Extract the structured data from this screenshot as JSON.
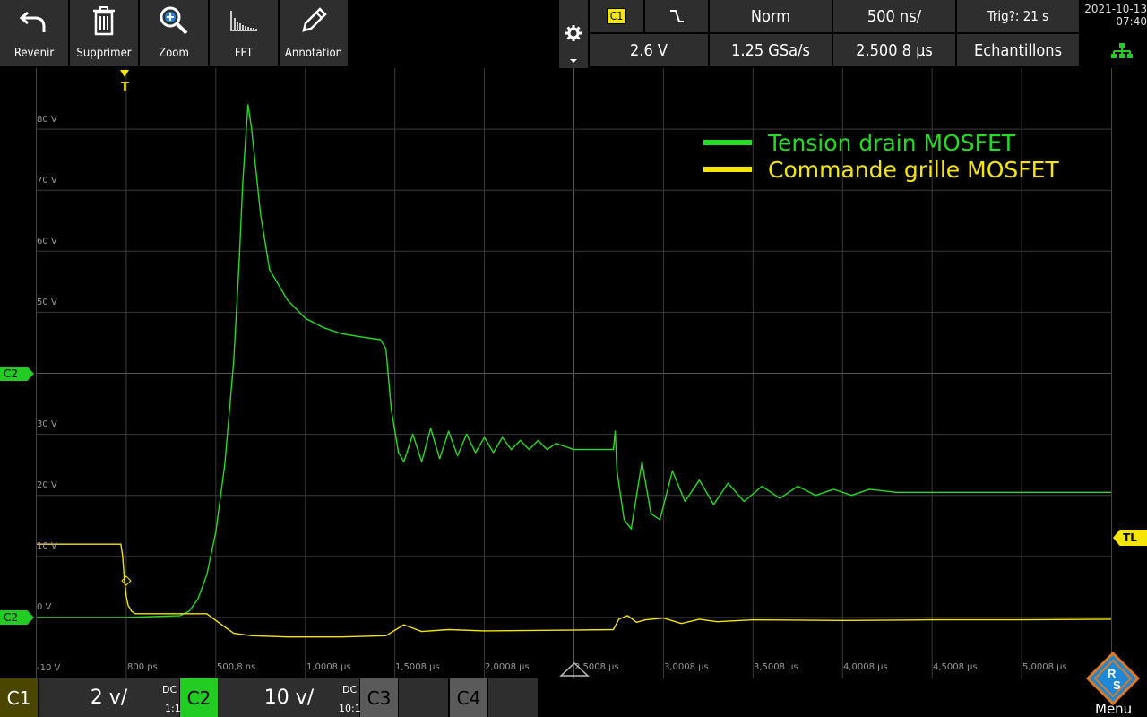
{
  "toolbar": {
    "buttons": [
      {
        "label": "Revenir",
        "icon": "undo-icon"
      },
      {
        "label": "Supprimer",
        "icon": "trash-icon"
      },
      {
        "label": "Zoom",
        "icon": "zoom-icon"
      },
      {
        "label": "FFT",
        "icon": "fft-icon"
      },
      {
        "label": "Annotation",
        "icon": "pencil-icon"
      }
    ],
    "trigger_source": "C1",
    "trigger_mode": "Norm",
    "timebase": "500 ns/",
    "trigger_status": "Trig?: 21 s",
    "trigger_level": "2.6 V",
    "sample_rate": "1.25 GSa/s",
    "position": "2.500 8 µs",
    "acquisition": "Echantillons",
    "date": "2021-10-13",
    "time": "07:40"
  },
  "grid": {
    "y_labels": [
      "80 V",
      "70 V",
      "60 V",
      "50 V",
      "30 V",
      "20 V",
      "10 V",
      "0 V",
      "-10 V"
    ],
    "x_labels": [
      "800 ps",
      "500,8 ns",
      "1,0008 µs",
      "1,5008 µs",
      "2,0008 µs",
      "2,5008 µs",
      "3,0008 µs",
      "3,5008 µs",
      "4,0008 µs",
      "4,5008 µs",
      "5,0008 µs"
    ],
    "marker_c2_upper": "C2",
    "marker_c2_lower": "C2",
    "marker_trigger_level": "TL",
    "trigger_pos_label": "T"
  },
  "legend": {
    "series_1": "Tension drain MOSFET",
    "series_2": "Commande grille MOSFET"
  },
  "colors": {
    "drain": "#22dd22",
    "gate": "#f5e600",
    "panel": "#2e2e2e",
    "grid": "#3a3a3a"
  },
  "bottom": {
    "c1_label": "C1",
    "c1_scale": "2 v/",
    "c1_coupling": "DC",
    "c1_probe": "1:1",
    "c2_label": "C2",
    "c2_scale": "10 v/",
    "c2_coupling": "DC",
    "c2_probe": "10:1",
    "c3_label": "C3",
    "c4_label": "C4",
    "menu_label": "Menu"
  },
  "chart_data": {
    "type": "line",
    "x_unit": "µs",
    "y_unit": "V",
    "xlim": [
      -0.5,
      5.5
    ],
    "ylim": [
      -10,
      90
    ],
    "series": [
      {
        "name": "Tension drain MOSFET",
        "points": [
          [
            -0.5,
            0
          ],
          [
            0,
            0
          ],
          [
            0.3,
            0.3
          ],
          [
            0.35,
            1
          ],
          [
            0.4,
            3
          ],
          [
            0.45,
            7
          ],
          [
            0.5,
            14
          ],
          [
            0.55,
            25
          ],
          [
            0.6,
            42
          ],
          [
            0.63,
            58
          ],
          [
            0.65,
            71
          ],
          [
            0.67,
            80
          ],
          [
            0.68,
            84
          ],
          [
            0.7,
            80
          ],
          [
            0.75,
            66
          ],
          [
            0.8,
            57
          ],
          [
            0.9,
            52
          ],
          [
            1.0,
            49
          ],
          [
            1.1,
            47.5
          ],
          [
            1.2,
            46.5
          ],
          [
            1.3,
            46
          ],
          [
            1.42,
            45.5
          ],
          [
            1.45,
            44
          ],
          [
            1.48,
            34
          ],
          [
            1.52,
            27
          ],
          [
            1.55,
            25.5
          ],
          [
            1.6,
            30
          ],
          [
            1.65,
            25.5
          ],
          [
            1.7,
            31
          ],
          [
            1.75,
            26
          ],
          [
            1.8,
            30.5
          ],
          [
            1.85,
            26.5
          ],
          [
            1.9,
            30
          ],
          [
            1.95,
            27
          ],
          [
            2.0,
            29.5
          ],
          [
            2.05,
            27
          ],
          [
            2.1,
            29.5
          ],
          [
            2.15,
            27.5
          ],
          [
            2.2,
            29
          ],
          [
            2.25,
            27.5
          ],
          [
            2.3,
            29
          ],
          [
            2.35,
            27.5
          ],
          [
            2.4,
            28.5
          ],
          [
            2.5,
            27.5
          ],
          [
            2.6,
            27.5
          ],
          [
            2.72,
            27.5
          ],
          [
            2.73,
            30.5
          ],
          [
            2.74,
            24
          ],
          [
            2.78,
            16
          ],
          [
            2.82,
            14.5
          ],
          [
            2.88,
            25.5
          ],
          [
            2.93,
            17
          ],
          [
            2.98,
            16
          ],
          [
            3.05,
            24
          ],
          [
            3.12,
            19
          ],
          [
            3.2,
            22.5
          ],
          [
            3.28,
            18.5
          ],
          [
            3.36,
            22
          ],
          [
            3.45,
            19
          ],
          [
            3.55,
            21.5
          ],
          [
            3.65,
            19.5
          ],
          [
            3.75,
            21.5
          ],
          [
            3.85,
            20
          ],
          [
            3.95,
            21
          ],
          [
            4.05,
            20
          ],
          [
            4.15,
            21
          ],
          [
            4.3,
            20.5
          ],
          [
            4.5,
            20.5
          ],
          [
            5.0,
            20.5
          ],
          [
            5.5,
            20.5
          ]
        ]
      },
      {
        "name": "Commande grille MOSFET",
        "points": [
          [
            -0.5,
            12
          ],
          [
            -0.03,
            12
          ],
          [
            -0.02,
            10
          ],
          [
            -0.01,
            6
          ],
          [
            0.0,
            3.5
          ],
          [
            0.01,
            2
          ],
          [
            0.03,
            1
          ],
          [
            0.05,
            0.6
          ],
          [
            0.3,
            0.6
          ],
          [
            0.45,
            0.6
          ],
          [
            0.5,
            -0.5
          ],
          [
            0.6,
            -2.6
          ],
          [
            0.7,
            -3
          ],
          [
            0.9,
            -3.2
          ],
          [
            1.2,
            -3.2
          ],
          [
            1.45,
            -3
          ],
          [
            1.55,
            -1.2
          ],
          [
            1.65,
            -2.3
          ],
          [
            1.8,
            -2.0
          ],
          [
            2.0,
            -2.2
          ],
          [
            2.4,
            -2.1
          ],
          [
            2.72,
            -2.0
          ],
          [
            2.75,
            -0.3
          ],
          [
            2.8,
            0.3
          ],
          [
            2.85,
            -0.8
          ],
          [
            2.9,
            -0.4
          ],
          [
            3.0,
            -0.1
          ],
          [
            3.1,
            -1.0
          ],
          [
            3.2,
            -0.3
          ],
          [
            3.3,
            -0.7
          ],
          [
            3.5,
            -0.4
          ],
          [
            4.0,
            -0.5
          ],
          [
            4.5,
            -0.4
          ],
          [
            5.0,
            -0.4
          ],
          [
            5.5,
            -0.3
          ]
        ]
      }
    ]
  }
}
